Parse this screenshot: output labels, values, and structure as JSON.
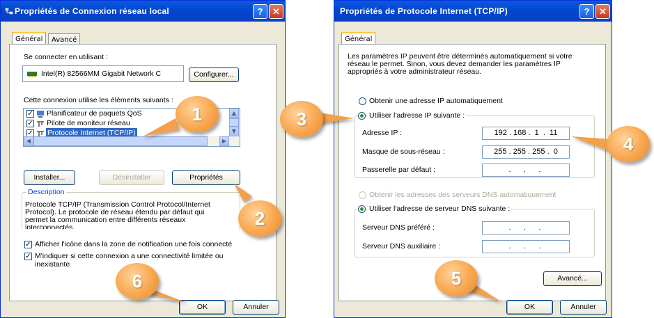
{
  "left_dialog": {
    "title": "Propriétés de Connexion réseau local",
    "tabs": [
      "Général",
      "Avancé"
    ],
    "connect_using_label": "Se connecter en utilisant :",
    "adapter_name": "Intel(R) 82566MM Gigabit Network C",
    "configure_button": "Configurer...",
    "components_label": "Cette connexion utilise les éléments suivants :",
    "components": [
      {
        "label": "Planificateur de paquets QoS",
        "checked": true,
        "icon": "qos-scheduler-icon"
      },
      {
        "label": "Pilote de moniteur réseau",
        "checked": true,
        "icon": "network-monitor-icon"
      },
      {
        "label": "Protocole Internet (TCP/IP)",
        "checked": true,
        "icon": "tcpip-icon",
        "selected": true
      }
    ],
    "install_button": "Installer...",
    "uninstall_button": "Désinstaller",
    "properties_button": "Propriétés",
    "description_title": "Description",
    "description_text": "Protocole TCP/IP (Transmission Control Protocol/Internet Protocol). Le protocole de réseau étendu par défaut qui permet la communication entre différents réseaux interconnectés.",
    "show_icon_checkbox": "Afficher l'icône dans la zone de notification une fois connecté",
    "notify_checkbox": "M'indiquer si cette connexion a une connectivité limitée ou inexistante",
    "ok_button": "OK",
    "cancel_button": "Annuler"
  },
  "right_dialog": {
    "title": "Propriétés de Protocole Internet (TCP/IP)",
    "tab": "Général",
    "intro_text": "Les paramètres IP peuvent être déterminés automatiquement si votre réseau le permet. Sinon, vous devez demander les paramètres IP appropriés à votre administrateur réseau.",
    "auto_ip_option": "Obtenir une adresse IP automatiquement",
    "manual_ip_option": "Utiliser l'adresse IP suivante :",
    "ip_address_label": "Adresse IP :",
    "ip_address_value": "192 . 168 .  1  .  11",
    "subnet_label": "Masque de sous-réseau :",
    "subnet_value": "255 . 255 . 255 .  0",
    "gateway_label": "Passerelle par défaut :",
    "gateway_value": "  .      .      .   ",
    "auto_dns_option": "Obtenir les adresses des serveurs DNS automatiquement",
    "manual_dns_option": "Utiliser l'adresse de serveur DNS suivante :",
    "preferred_dns_label": "Serveur DNS préféré :",
    "preferred_dns_value": "  .      .      .   ",
    "alternate_dns_label": "Serveur DNS auxiliaire :",
    "alternate_dns_value": "  .      .      .   ",
    "advanced_button": "Avancé...",
    "ok_button": "OK",
    "cancel_button": "Annuler"
  },
  "callouts": [
    "1",
    "2",
    "3",
    "4",
    "5",
    "6"
  ],
  "colors": {
    "callout": "#f8a74f",
    "titlebar": "#0446cf",
    "selection": "#316ac5"
  }
}
